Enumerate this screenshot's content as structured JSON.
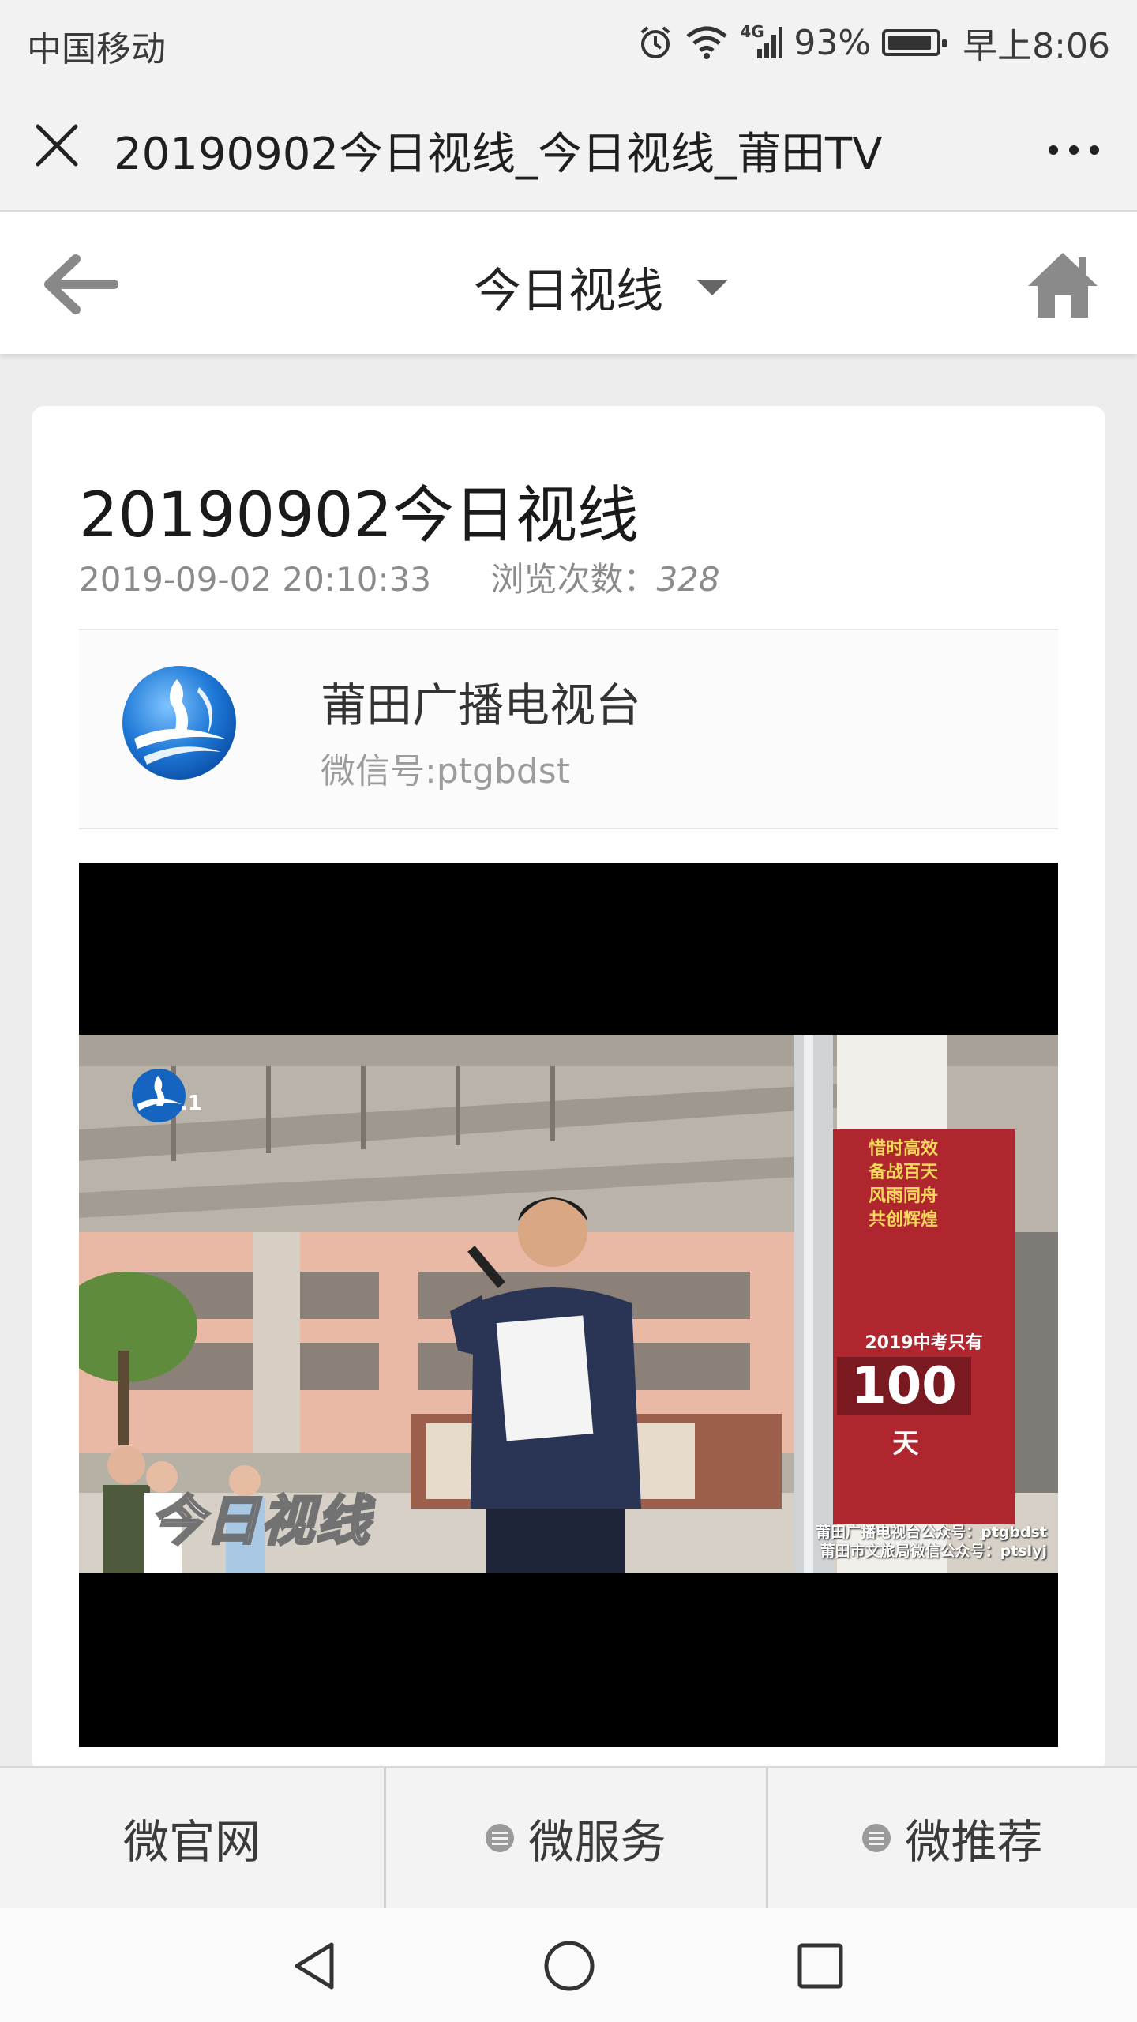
{
  "status_bar": {
    "carrier": "中国移动",
    "network": "4G",
    "battery": "93%",
    "time": "早上8:06",
    "icons": [
      "alarm-icon",
      "wifi-icon",
      "signal-icon",
      "battery-icon"
    ]
  },
  "webview": {
    "title": "20190902今日视线_今日视线_莆田TV",
    "close_icon": "close-icon",
    "more_icon": "more-icon"
  },
  "nav": {
    "title": "今日视线",
    "back_icon": "back-arrow-icon",
    "home_icon": "home-icon"
  },
  "article": {
    "title": "20190902今日视线",
    "datetime": "2019-09-02 20:10:33",
    "views_label": "浏览次数：",
    "views": "328"
  },
  "source": {
    "name": "莆田广播电视台",
    "wechat_id": "微信号:ptgbdst"
  },
  "video": {
    "overlay_logo": "今日视线",
    "banner_lines": [
      "惜时高效",
      "备战百天",
      "风雨同舟",
      "共创辉煌"
    ],
    "banner_caption": "2019中考只有",
    "banner_number": "100",
    "banner_unit": "天",
    "footer_line1": "莆田广播电视台公众号：ptgbdst",
    "footer_line2": "莆田市文旅局微信公众号：ptslyj",
    "channel_mark": ".1"
  },
  "tabbar": {
    "tabs": [
      "微官网",
      "微服务",
      "微推荐"
    ]
  },
  "colors": {
    "accent_blue": "#1565c0",
    "banner_red": "#b0262e"
  }
}
